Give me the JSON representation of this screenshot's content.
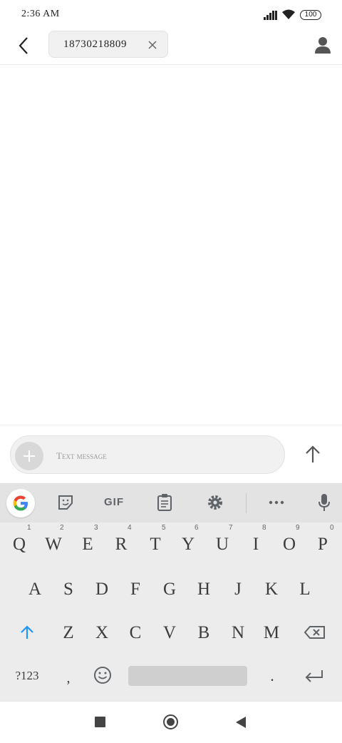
{
  "status_bar": {
    "time": "2:36 AM",
    "battery": "100"
  },
  "header": {
    "recipient": "18730218809"
  },
  "compose": {
    "placeholder": "Text message"
  },
  "keyboard": {
    "toolbar": {
      "gif_label": "GIF"
    },
    "row1": [
      "Q",
      "W",
      "E",
      "R",
      "T",
      "Y",
      "U",
      "I",
      "O",
      "P"
    ],
    "row1_hints": [
      "1",
      "2",
      "3",
      "4",
      "5",
      "6",
      "7",
      "8",
      "9",
      "0"
    ],
    "row2": [
      "A",
      "S",
      "D",
      "F",
      "G",
      "H",
      "J",
      "K",
      "L"
    ],
    "row3": [
      "Z",
      "X",
      "C",
      "V",
      "B",
      "N",
      "M"
    ],
    "symbols_label": "?123",
    "comma": ",",
    "period": "."
  },
  "colors": {
    "accent": "#2196f3",
    "key_text": "#3c3c3c",
    "keyboard_bg": "#ececec"
  }
}
